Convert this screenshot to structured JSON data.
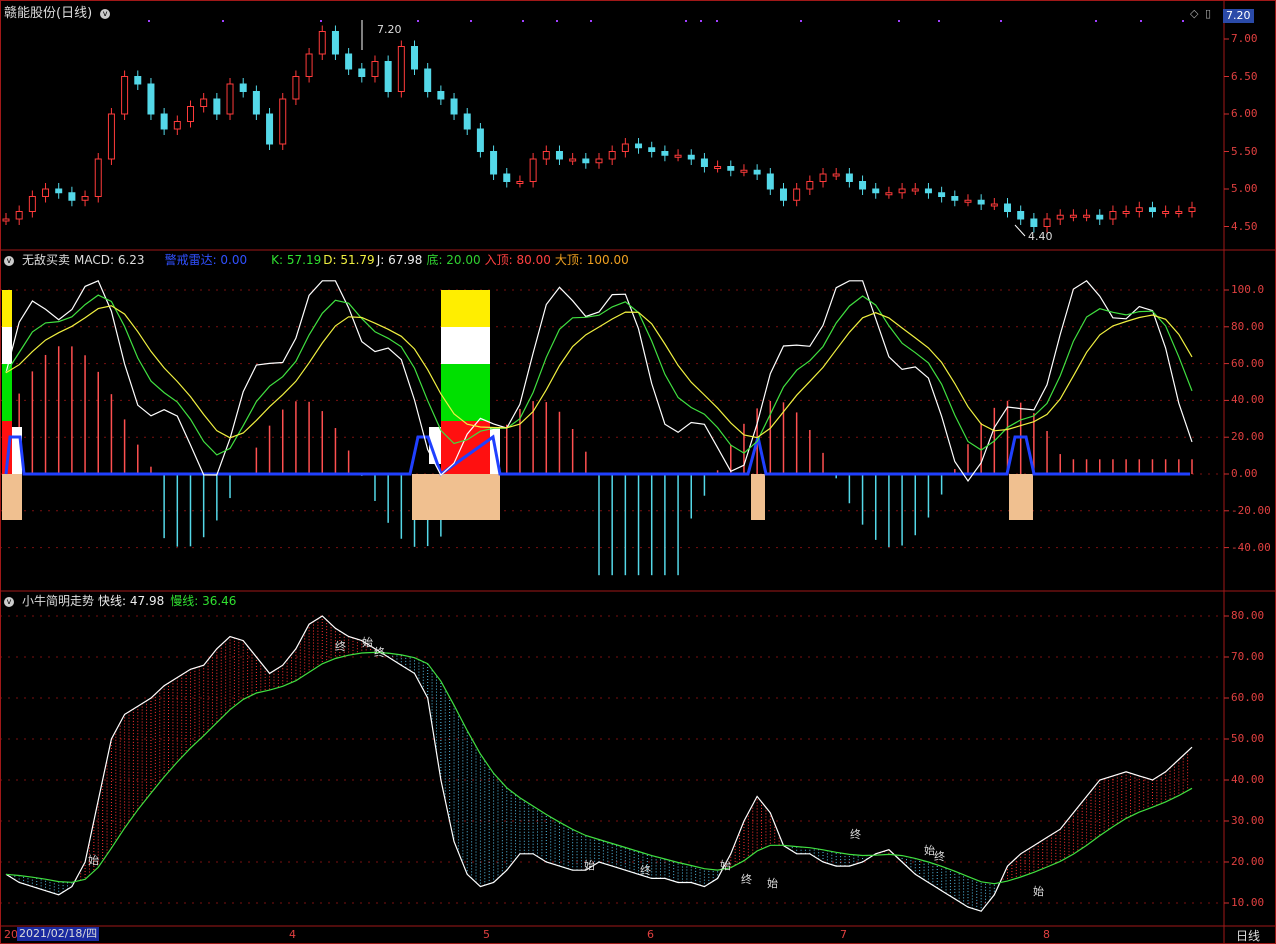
{
  "colors": {
    "up": "#ff3b3b",
    "down": "#54d8e8",
    "frame": "#a01818",
    "grid": "#7a1010",
    "blue": "#2040ff"
  },
  "panel1": {
    "title": "赣能股份(日线)",
    "price_tag": "7.20",
    "high_label": "7.20",
    "low_label": "4.40",
    "y_ticks": [
      "7.00",
      "6.50",
      "6.00",
      "5.50",
      "5.00",
      "4.50"
    ]
  },
  "panel2": {
    "name": "无敌买卖",
    "macd": "MACD: 6.23",
    "warn": "警戒雷达: 0.00",
    "k": "K: 57.19",
    "d": "D: 51.79",
    "j": "J: 67.98",
    "bottom": "底: 20.00",
    "entry": "入顶: 80.00",
    "top": "大顶: 100.00",
    "y_ticks": [
      "100.0",
      "80.00",
      "60.00",
      "40.00",
      "20.00",
      "0.00",
      "-20.00",
      "-40.00"
    ]
  },
  "panel3": {
    "name": "小牛简明走势",
    "fast": "快线: 47.98",
    "slow": "慢线: 36.46",
    "y_ticks": [
      "80.00",
      "70.00",
      "60.00",
      "50.00",
      "40.00",
      "30.00",
      "20.00",
      "10.00"
    ],
    "annotations": [
      "始",
      "终",
      "始",
      "终",
      "始",
      "终",
      "始",
      "终",
      "始",
      "终",
      "始",
      "终",
      "始"
    ]
  },
  "xaxis": {
    "date": "2021/02/18/四",
    "left_cut": "20",
    "months": [
      "4",
      "5",
      "6",
      "7",
      "8"
    ],
    "period": "日线"
  }
}
